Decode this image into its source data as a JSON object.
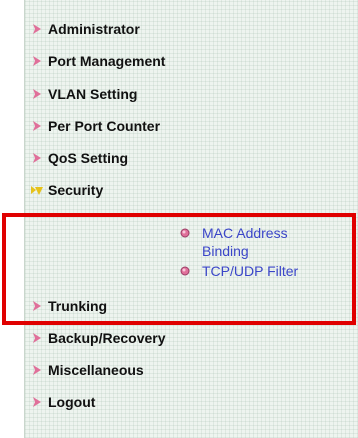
{
  "menu": {
    "items": [
      {
        "label": "Administrator",
        "icon": "pink-arrow-icon"
      },
      {
        "label": "Port Management",
        "icon": "pink-arrow-icon"
      },
      {
        "label": "VLAN Setting",
        "icon": "pink-arrow-icon"
      },
      {
        "label": "Per Port Counter",
        "icon": "pink-arrow-icon"
      },
      {
        "label": "QoS Setting",
        "icon": "pink-arrow-icon"
      },
      {
        "label": "Security",
        "icon": "yellow-expanded-arrow-icon"
      },
      {
        "label": "Trunking",
        "icon": "pink-arrow-icon"
      },
      {
        "label": "Backup/Recovery",
        "icon": "pink-arrow-icon"
      },
      {
        "label": "Miscellaneous",
        "icon": "pink-arrow-icon"
      },
      {
        "label": "Logout",
        "icon": "pink-arrow-icon"
      }
    ],
    "security_submenu": [
      {
        "label": "MAC Address Binding",
        "icon": "bullet-icon"
      },
      {
        "label": "TCP/UDP Filter",
        "icon": "bullet-icon"
      }
    ]
  },
  "colors": {
    "arrow": "#e0709a",
    "expanded_arrow": "#e6c21a",
    "link": "#3a45c8",
    "highlight": "#e00000"
  }
}
